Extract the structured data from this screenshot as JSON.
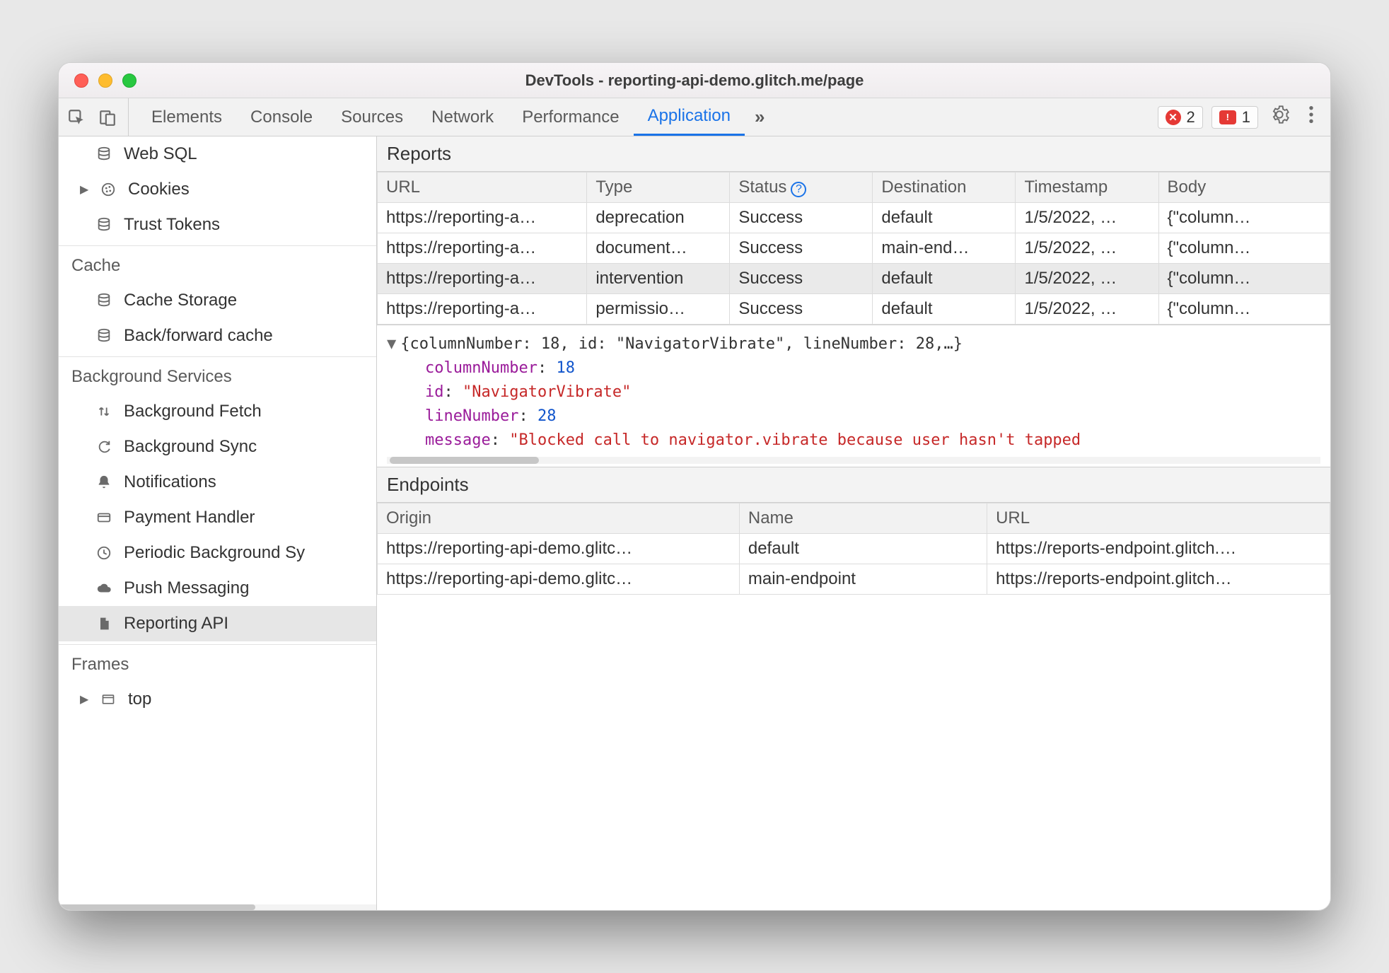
{
  "window_title": "DevTools - reporting-api-demo.glitch.me/page",
  "toolbar": {
    "tabs": [
      "Elements",
      "Console",
      "Sources",
      "Network",
      "Performance",
      "Application"
    ],
    "active_tab_index": 5,
    "error_count": "2",
    "issue_count": "1"
  },
  "sidebar": {
    "top_items": [
      {
        "icon": "db-icon",
        "label": "Web SQL",
        "expandable": false
      },
      {
        "icon": "cookie-icon",
        "label": "Cookies",
        "expandable": true
      },
      {
        "icon": "db-icon",
        "label": "Trust Tokens",
        "expandable": false
      }
    ],
    "cache_title": "Cache",
    "cache_items": [
      {
        "icon": "db-icon",
        "label": "Cache Storage"
      },
      {
        "icon": "db-icon",
        "label": "Back/forward cache"
      }
    ],
    "bg_title": "Background Services",
    "bg_items": [
      {
        "icon": "updown-icon",
        "label": "Background Fetch"
      },
      {
        "icon": "sync-icon",
        "label": "Background Sync"
      },
      {
        "icon": "bell-icon",
        "label": "Notifications"
      },
      {
        "icon": "card-icon",
        "label": "Payment Handler"
      },
      {
        "icon": "clock-icon",
        "label": "Periodic Background Sy"
      },
      {
        "icon": "cloud-icon",
        "label": "Push Messaging"
      },
      {
        "icon": "page-icon",
        "label": "Reporting API",
        "selected": true
      }
    ],
    "frames_title": "Frames",
    "frames_items": [
      {
        "icon": "frame-icon",
        "label": "top",
        "expandable": true
      }
    ]
  },
  "reports": {
    "title": "Reports",
    "columns": [
      "URL",
      "Type",
      "Status",
      "Destination",
      "Timestamp",
      "Body"
    ],
    "rows": [
      {
        "url": "https://reporting-a…",
        "type": "deprecation",
        "status": "Success",
        "dest": "default",
        "ts": "1/5/2022, …",
        "body": "{\"column…"
      },
      {
        "url": "https://reporting-a…",
        "type": "document…",
        "status": "Success",
        "dest": "main-end…",
        "ts": "1/5/2022, …",
        "body": "{\"column…"
      },
      {
        "url": "https://reporting-a…",
        "type": "intervention",
        "status": "Success",
        "dest": "default",
        "ts": "1/5/2022, …",
        "body": "{\"column…",
        "selected": true
      },
      {
        "url": "https://reporting-a…",
        "type": "permissio…",
        "status": "Success",
        "dest": "default",
        "ts": "1/5/2022, …",
        "body": "{\"column…"
      }
    ]
  },
  "detail": {
    "summary": "{columnNumber: 18, id: \"NavigatorVibrate\", lineNumber: 28,…}",
    "props": {
      "columnNumber": "18",
      "id": "\"NavigatorVibrate\"",
      "lineNumber": "28",
      "message": "\"Blocked call to navigator.vibrate because user hasn't tapped"
    }
  },
  "endpoints": {
    "title": "Endpoints",
    "columns": [
      "Origin",
      "Name",
      "URL"
    ],
    "rows": [
      {
        "origin": "https://reporting-api-demo.glitc…",
        "name": "default",
        "url": "https://reports-endpoint.glitch.…"
      },
      {
        "origin": "https://reporting-api-demo.glitc…",
        "name": "main-endpoint",
        "url": "https://reports-endpoint.glitch…"
      }
    ]
  }
}
